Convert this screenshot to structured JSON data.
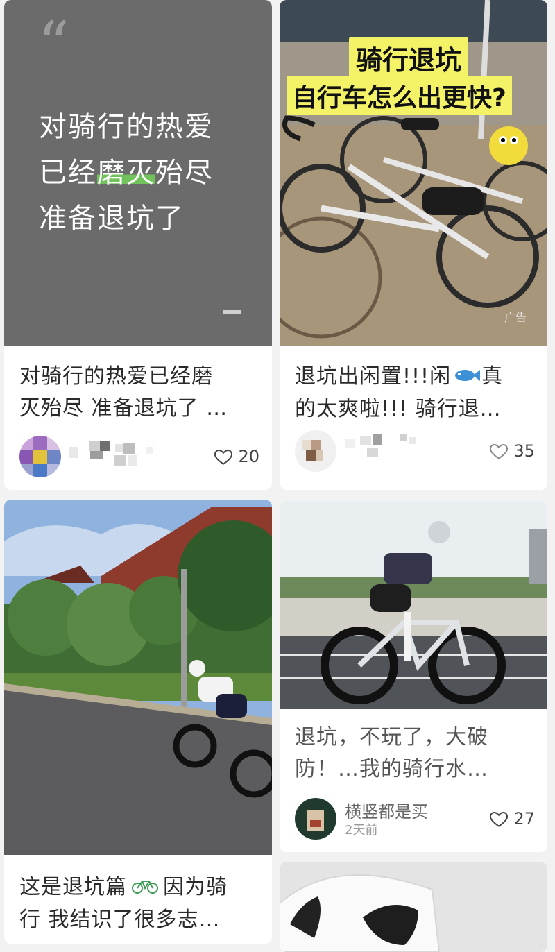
{
  "feed": {
    "cards": [
      {
        "quote_mark": "“",
        "quote_lines": [
          "对骑行的热爱",
          "已经",
          "磨灭",
          "殆尽",
          "准备退坑了"
        ],
        "title_lines": [
          "对骑行的热爱已经磨",
          "灭殆尽 准备退坑了 …"
        ],
        "likes": "20"
      },
      {
        "ad_headline_1": "骑行退坑",
        "ad_headline_2": "自行车怎么出更快?",
        "ad_label": "广告",
        "title_lines": [
          "退坑出闲置!!!闲",
          "真",
          "的太爽啦!!! 骑行退…"
        ],
        "likes": "35"
      },
      {
        "title_lines": [
          "这是退坑篇",
          "因为骑",
          "行 我结识了很多志…"
        ]
      },
      {
        "title_lines": [
          "退坑，不玩了，大破",
          "防！…我的骑行水…"
        ],
        "author": "横竖都是买",
        "time": "2天前",
        "likes": "27"
      }
    ]
  },
  "colors": {
    "background": "#f2f2f2",
    "quote_card": "#6b6b6b",
    "highlight_green": "#6fc35a",
    "ad_yellow": "#f4f267"
  },
  "icons": [
    "heart-icon",
    "fish-emoji-icon",
    "bicycle-emoji-icon"
  ]
}
